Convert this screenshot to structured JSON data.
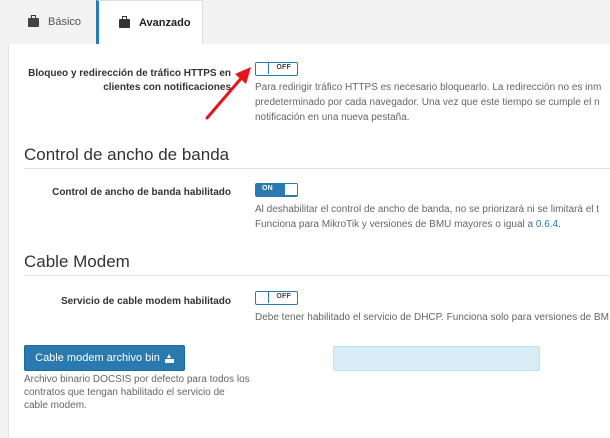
{
  "tabs": [
    {
      "label": "Básico",
      "icon": "briefcase-icon",
      "active": false
    },
    {
      "label": "Avanzado",
      "icon": "briefcase-icon",
      "active": true
    }
  ],
  "https_block": {
    "label_line1": "Bloqueo y redirección de tráfico HTTPS en",
    "label_line2": "clientes con notificaciones",
    "toggle_text": "OFF",
    "help_line1": "Para redirigir tráfico HTTPS es necesario bloquearlo. La redirección no es inm",
    "help_line2": "predeterminado por cada navegador. Una vez que este tiempo se cumple el n",
    "help_line3": "notificación en una nueva pestaña."
  },
  "bandwidth": {
    "section_title": "Control de ancho de banda",
    "label": "Control de ancho de banda habilitado",
    "toggle_text": "ON",
    "help_line1": "Al deshabilitar el control de ancho de banda, no se priorizará ni se limitará el t",
    "help_line2_prefix": "Funciona para MikroTik y versiones de BMU mayores o igual a ",
    "help_link": "0.6.4",
    "help_line2_suffix": "."
  },
  "cable_modem": {
    "section_title": "Cable Modem",
    "label": "Servicio de cable modem habilitado",
    "toggle_text": "OFF",
    "help": "Debe tener habilitado el servicio de DHCP. Funciona solo para versiones de BM",
    "upload_button_label": "Cable modem archivo bin",
    "upload_help_line1": "Archivo binario DOCSIS por defecto para todos los",
    "upload_help_line2": "contratos que tengan habilitado el servicio de",
    "upload_help_line3": "cable modem."
  },
  "colors": {
    "accent": "#2a7ab0",
    "annotation_arrow": "#e8141b",
    "file_box": "#d9edf7"
  }
}
